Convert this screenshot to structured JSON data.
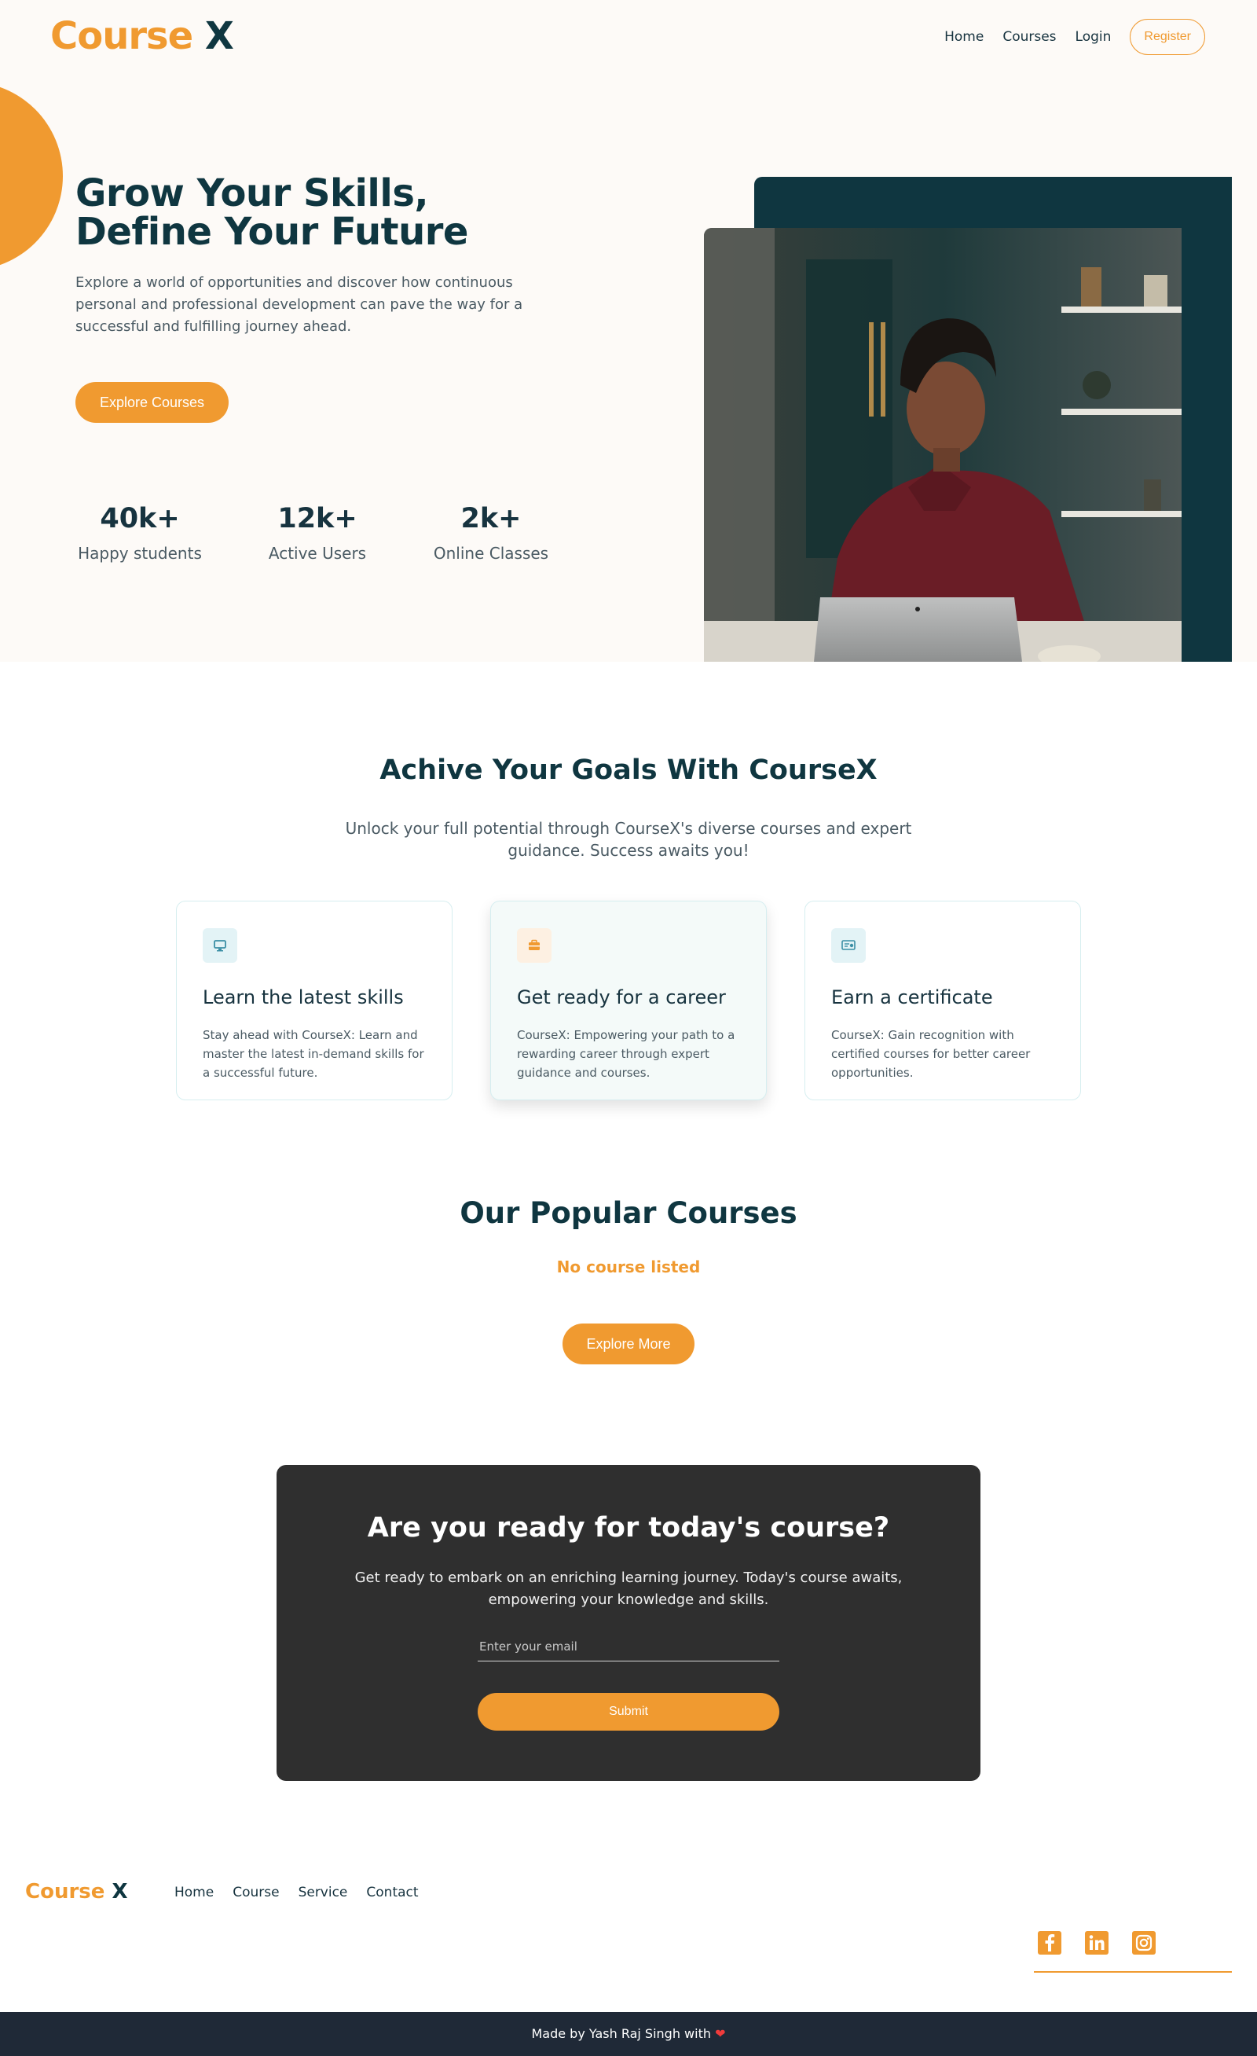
{
  "brand": {
    "name_part1": "Course",
    "name_part2": "X",
    "accent": "#f09a30",
    "dark": "#0f3640"
  },
  "nav": {
    "home": "Home",
    "courses": "Courses",
    "login": "Login",
    "register": "Register"
  },
  "hero": {
    "title_line1": "Grow Your Skills,",
    "title_line2": "Define Your Future",
    "text": "Explore a world of opportunities and discover how continuous personal and professional development can pave the way for a successful and fulfilling journey ahead.",
    "button": "Explore Courses",
    "stats": [
      {
        "value": "40k+",
        "label": "Happy students"
      },
      {
        "value": "12k+",
        "label": "Active Users"
      },
      {
        "value": "2k+",
        "label": "Online Classes"
      }
    ]
  },
  "goals": {
    "title": "Achive Your Goals With CourseX",
    "subtitle": "Unlock your full potential through CourseX's diverse courses and expert guidance. Success awaits you!",
    "cards": [
      {
        "icon": "monitor-icon",
        "title": "Learn the latest skills",
        "text": "Stay ahead with CourseX: Learn and master the latest in-demand skills for a successful future."
      },
      {
        "icon": "briefcase-icon",
        "title": "Get ready for a career",
        "text": "CourseX: Empowering your path to a rewarding career through expert guidance and courses."
      },
      {
        "icon": "certificate-icon",
        "title": "Earn a certificate",
        "text": "CourseX: Gain recognition with certified courses for better career opportunities."
      }
    ]
  },
  "popular": {
    "title": "Our Popular Courses",
    "empty": "No course listed",
    "button": "Explore More"
  },
  "cta": {
    "title": "Are you ready for today's course?",
    "text": "Get ready to embark on an enriching learning journey. Today's course awaits, empowering your knowledge and skills.",
    "email_placeholder": "Enter your email",
    "submit": "Submit"
  },
  "footer": {
    "nav": {
      "home": "Home",
      "course": "Course",
      "service": "Service",
      "contact": "Contact"
    },
    "socials": [
      "facebook-icon",
      "linkedin-icon",
      "instagram-icon"
    ],
    "credit": "Made by Yash Raj Singh with"
  }
}
